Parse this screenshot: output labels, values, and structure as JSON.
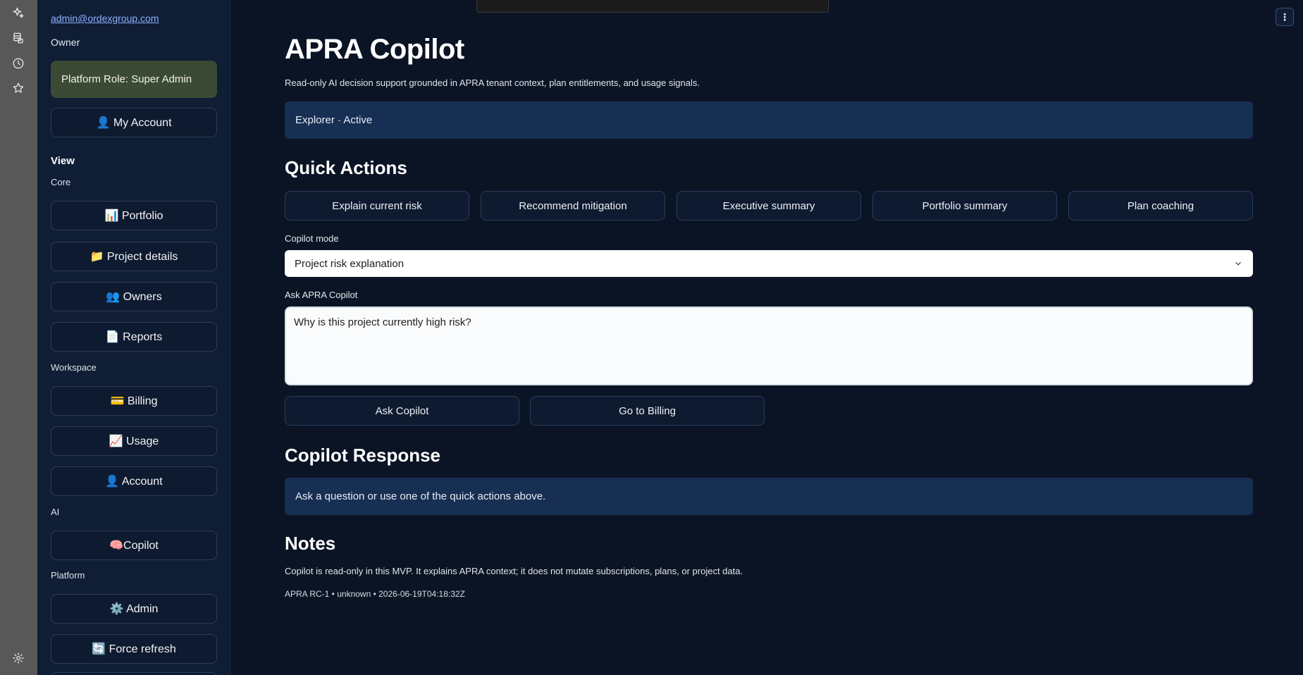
{
  "rail": {
    "icons": [
      "sparkle-icon",
      "database-icon",
      "clock-icon",
      "star-icon",
      "settings-icon"
    ]
  },
  "sidebar": {
    "email": "admin@ordexgroup.com",
    "role": "Owner",
    "platform_role": "Platform Role: Super Admin",
    "my_account": "👤 My Account",
    "view_heading": "View",
    "core_label": "Core",
    "portfolio": "📊 Portfolio",
    "project_details": "📁 Project details",
    "owners": "👥 Owners",
    "reports": "📄 Reports",
    "workspace_label": "Workspace",
    "billing": "💳 Billing",
    "usage": "📈 Usage",
    "account": "👤 Account",
    "ai_label": "AI",
    "copilot": "🧠Copilot",
    "platform_label": "Platform",
    "admin": "⚙️ Admin",
    "force_refresh": "🔄 Force refresh"
  },
  "main": {
    "title": "APRA Copilot",
    "subtitle": "Read-only AI decision support grounded in APRA tenant context, plan entitlements, and usage signals.",
    "status": "Explorer · Active",
    "quick_actions_heading": "Quick Actions",
    "quick_actions": [
      "Explain current risk",
      "Recommend mitigation",
      "Executive summary",
      "Portfolio summary",
      "Plan coaching"
    ],
    "copilot_mode_label": "Copilot mode",
    "copilot_mode_value": "Project risk explanation",
    "ask_label": "Ask APRA Copilot",
    "ask_value": "Why is this project currently high risk?",
    "ask_button": "Ask Copilot",
    "billing_button": "Go to Billing",
    "response_heading": "Copilot Response",
    "response_text": "Ask a question or use one of the quick actions above.",
    "notes_heading": "Notes",
    "notes_text": "Copilot is read-only in this MVP. It explains APRA context; it does not mutate subscriptions, plans, or project data.",
    "footer": "APRA RC-1 • unknown • 2026-06-19T04:18:32Z"
  },
  "colors": {
    "background": "#0b1424",
    "sidebar": "#0f1d35",
    "info_box": "#172f52",
    "platform_role_bg": "#3b4a34",
    "button_border": "#2a3d5c"
  }
}
